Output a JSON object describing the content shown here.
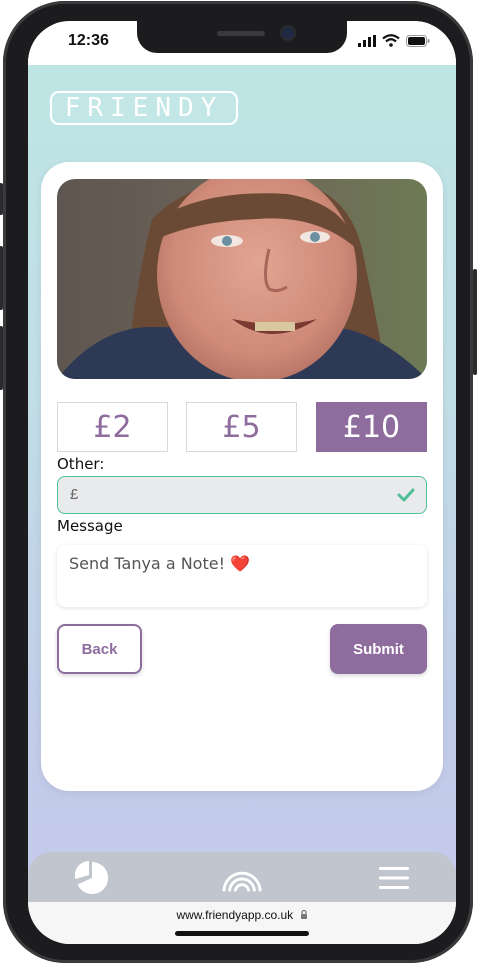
{
  "status_bar": {
    "time": "12:36"
  },
  "app": {
    "logo_text": "FRIENDY"
  },
  "donation": {
    "amounts": [
      {
        "label": "£2",
        "selected": false
      },
      {
        "label": "£5",
        "selected": false
      },
      {
        "label": "£10",
        "selected": true
      }
    ],
    "other_label": "Other:",
    "other_currency": "£",
    "other_value": "",
    "message_label": "Message",
    "message_placeholder": "Send Tanya a Note! ❤️",
    "back_label": "Back",
    "submit_label": "Submit"
  },
  "bottom_nav": {
    "items": [
      {
        "icon": "pie-chart-icon"
      },
      {
        "icon": "rainbow-icon"
      },
      {
        "icon": "menu-icon"
      }
    ]
  },
  "browser": {
    "url": "www.friendyapp.co.uk"
  },
  "colors": {
    "accent": "#8e6d9e",
    "valid": "#4fc19a",
    "background_top": "#bde6e4",
    "background_bottom": "#c4c8ea"
  }
}
